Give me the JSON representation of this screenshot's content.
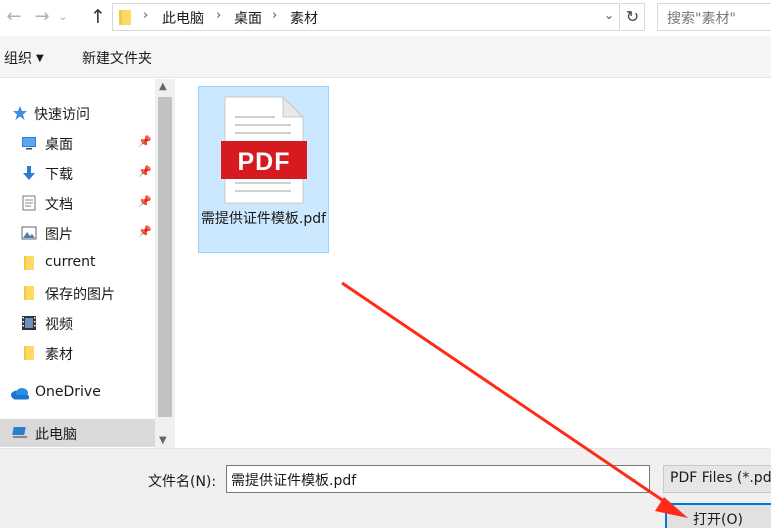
{
  "address_bar": {
    "breadcrumbs": [
      "此电脑",
      "桌面",
      "素材"
    ],
    "search_placeholder": "搜索\"素材\""
  },
  "command_bar": {
    "organize_label": "组织",
    "new_folder_label": "新建文件夹"
  },
  "nav_pane": {
    "items": [
      {
        "label": "快速访问",
        "icon": "star-icon",
        "pinned": false
      },
      {
        "label": "桌面",
        "icon": "desktop-icon",
        "pinned": true
      },
      {
        "label": "下载",
        "icon": "download-icon",
        "pinned": true
      },
      {
        "label": "文档",
        "icon": "document-icon",
        "pinned": true
      },
      {
        "label": "图片",
        "icon": "picture-icon",
        "pinned": true
      },
      {
        "label": "current",
        "icon": "folder-icon",
        "pinned": false
      },
      {
        "label": "保存的图片",
        "icon": "folder-icon",
        "pinned": false
      },
      {
        "label": "视频",
        "icon": "video-icon",
        "pinned": false
      },
      {
        "label": "素材",
        "icon": "folder-icon",
        "pinned": false
      },
      {
        "label": "OneDrive",
        "icon": "cloud-icon",
        "pinned": false
      },
      {
        "label": "此电脑",
        "icon": "computer-icon",
        "pinned": false,
        "selected": true
      }
    ]
  },
  "files": [
    {
      "name": "需提供证件模板.pdf",
      "badge": "PDF",
      "selected": true
    }
  ],
  "bottom": {
    "filename_label": "文件名(N):",
    "filename_value": "需提供证件模板.pdf",
    "filetype_value": "PDF Files (*.pdf)",
    "open_label": "打开(O)"
  },
  "colors": {
    "selection": "#cce8ff",
    "selection_border": "#99d1ff",
    "pdf_red": "#d71920",
    "annotation_red": "#ff2a1a",
    "accent": "#0078d7"
  }
}
